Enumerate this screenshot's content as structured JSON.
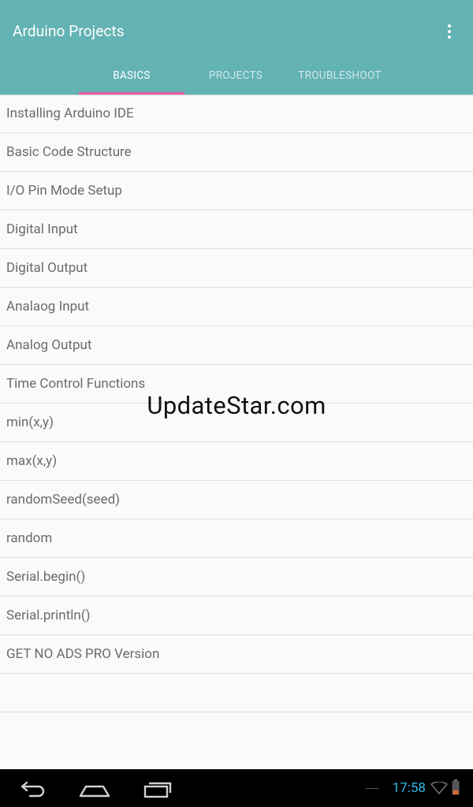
{
  "app": {
    "title": "Arduino Projects",
    "menu_icon": "overflow-menu-icon"
  },
  "tabs": [
    {
      "label": "BASICS",
      "active": true
    },
    {
      "label": "PROJECTS",
      "active": false
    },
    {
      "label": "TROUBLESHOOT",
      "active": false
    }
  ],
  "list": {
    "items": [
      "Installing Arduino IDE",
      "Basic Code Structure",
      "I/O Pin Mode Setup",
      "Digital Input",
      "Digital Output",
      "Analaog Input",
      "Analog Output",
      "Time Control Functions",
      "min(x,y)",
      "max(x,y)",
      "randomSeed(seed)",
      "random",
      "Serial.begin()",
      "Serial.println()",
      "GET NO ADS PRO Version"
    ]
  },
  "watermark": "UpdateStar.com",
  "system": {
    "time": "17:58",
    "icons": [
      "back-icon",
      "home-icon",
      "recents-icon",
      "wifi-icon",
      "battery-icon"
    ]
  },
  "colors": {
    "appbar": "#63b2b4",
    "tab_indicator": "#e85a9e",
    "clock": "#33b5e5"
  }
}
